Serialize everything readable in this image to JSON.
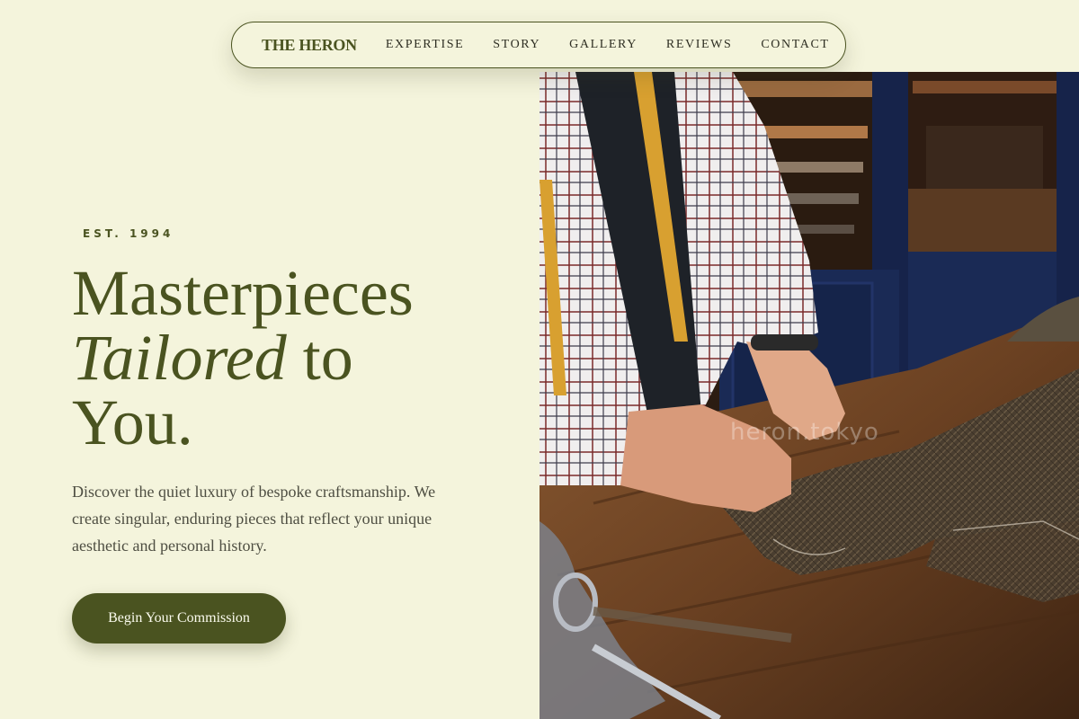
{
  "nav": {
    "brand": "THE HERON",
    "links": [
      "EXPERTISE",
      "STORY",
      "GALLERY",
      "REVIEWS",
      "CONTACT"
    ]
  },
  "hero": {
    "eyebrow": "EST. 1994",
    "headline_line1": "Masterpieces",
    "headline_italic": "Tailored",
    "headline_line2_rest": " to",
    "headline_line3": "You.",
    "description": "Discover the quiet luxury of bespoke craftsmanship. We create singular, enduring pieces that reflect your unique aesthetic and personal history.",
    "cta_label": "Begin Your Commission"
  },
  "image": {
    "watermark": "heron.tokyo"
  },
  "colors": {
    "background": "#f4f4dc",
    "accent": "#4a5320",
    "body_text": "#4e4e42"
  }
}
